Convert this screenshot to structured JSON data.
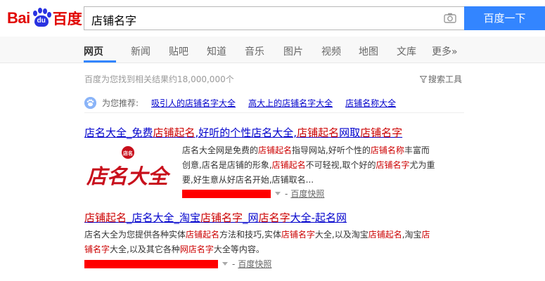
{
  "logo": {
    "part1": "Bai",
    "part2": "du",
    "part3": "百度"
  },
  "search": {
    "query": "店铺名字",
    "button_label": "百度一下"
  },
  "tabs": [
    "网页",
    "新闻",
    "贴吧",
    "知道",
    "音乐",
    "图片",
    "视频",
    "地图",
    "文库",
    "更多»"
  ],
  "result_count": "百度为您找到相关结果约18,000,000个",
  "search_tools": "搜索工具",
  "recommend": {
    "label": "为您推荐:",
    "links": [
      "吸引人的店铺名字大全",
      "高大上的店铺名字大全",
      "店铺名称大全"
    ]
  },
  "results": [
    {
      "title_parts": [
        {
          "t": "店名大全_免费",
          "em": false
        },
        {
          "t": "店铺起名",
          "em": true
        },
        {
          "t": ",好听的个性店名大全,",
          "em": false
        },
        {
          "t": "店铺起名",
          "em": true
        },
        {
          "t": "网取",
          "em": false
        },
        {
          "t": "店铺名字",
          "em": true
        }
      ],
      "thumbnail": {
        "badge": "店名",
        "text": "店名大全"
      },
      "abstract_lines": [
        [
          {
            "t": "店名大全网是免费的",
            "em": false
          },
          {
            "t": "店铺起名",
            "em": true
          },
          {
            "t": "指导网站,好听个性的",
            "em": false
          },
          {
            "t": "店铺名称",
            "em": true
          },
          {
            "t": "丰富而",
            "em": false
          }
        ],
        [
          {
            "t": "创意,店名是店铺的形象,",
            "em": false
          },
          {
            "t": "店铺起名",
            "em": true
          },
          {
            "t": "不可轻视,取个好的",
            "em": false
          },
          {
            "t": "店铺名字",
            "em": true
          },
          {
            "t": "尤为重",
            "em": false
          }
        ],
        [
          {
            "t": "要,好生意从好店名开始,店铺取名...",
            "em": false
          }
        ]
      ],
      "snapshot": "百度快照"
    },
    {
      "title_parts": [
        {
          "t": "店铺起名",
          "em": true
        },
        {
          "t": "_店名大全_淘宝",
          "em": false
        },
        {
          "t": "店铺名字",
          "em": true
        },
        {
          "t": "_网",
          "em": false
        },
        {
          "t": "店名字",
          "em": true
        },
        {
          "t": "大全-起名网",
          "em": false
        }
      ],
      "abstract_lines": [
        [
          {
            "t": "店名大全为您提供各种实体",
            "em": false
          },
          {
            "t": "店铺起名",
            "em": true
          },
          {
            "t": "方法和技巧,实体",
            "em": false
          },
          {
            "t": "店铺名字",
            "em": true
          },
          {
            "t": "大全,以及淘宝",
            "em": false
          },
          {
            "t": "店铺起名",
            "em": true
          },
          {
            "t": ",淘宝",
            "em": false
          },
          {
            "t": "店",
            "em": true
          }
        ],
        [
          {
            "t": "铺名字",
            "em": true
          },
          {
            "t": "大全,以及其它各种",
            "em": false
          },
          {
            "t": "网店名字",
            "em": true
          },
          {
            "t": "大全等内容。",
            "em": false
          }
        ]
      ],
      "snapshot": "百度快照"
    }
  ],
  "colors": {
    "brand_red": "#e10602",
    "brand_blue": "#2932e1",
    "button_blue": "#3385ff",
    "link": "#0000cc",
    "highlight": "#cc0000",
    "redaction": "#ff0000"
  }
}
